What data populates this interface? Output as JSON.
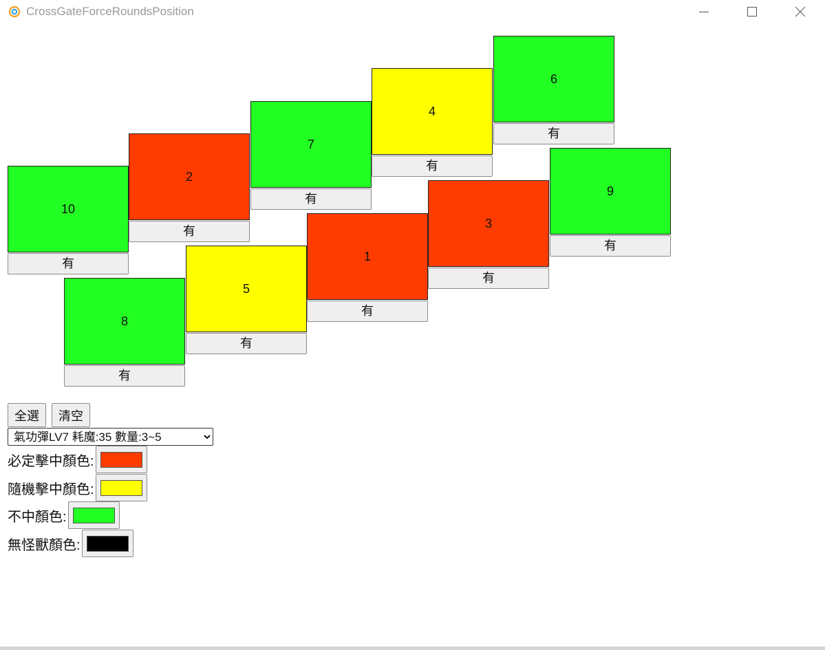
{
  "window": {
    "title": "CrossGateForceRoundsPosition"
  },
  "colors": {
    "must_hit": "#ff3c00",
    "random_hit": "#ffff00",
    "miss": "#22ff22",
    "no_monster": "#000000"
  },
  "slots": [
    {
      "number": "10",
      "status": "must_hit_no",
      "color": "#22ff22",
      "button": "有"
    },
    {
      "number": "2",
      "color": "#ff3c00",
      "button": "有"
    },
    {
      "number": "7",
      "color": "#22ff22",
      "button": "有"
    },
    {
      "number": "4",
      "color": "#ffff00",
      "button": "有"
    },
    {
      "number": "6",
      "color": "#22ff22",
      "button": "有"
    },
    {
      "number": "8",
      "color": "#22ff22",
      "button": "有"
    },
    {
      "number": "5",
      "color": "#ffff00",
      "button": "有"
    },
    {
      "number": "1",
      "color": "#ff3c00",
      "button": "有"
    },
    {
      "number": "3",
      "color": "#ff3c00",
      "button": "有"
    },
    {
      "number": "9",
      "color": "#22ff22",
      "button": "有"
    }
  ],
  "controls": {
    "select_all": "全選",
    "clear": "清空",
    "skill_selected": "氣功彈LV7 耗魔:35 數量:3~5"
  },
  "labels": {
    "must_hit": "必定擊中顏色:",
    "random_hit": "隨機擊中顏色:",
    "miss": "不中顏色:",
    "no_monster": "無怪獸顏色:"
  }
}
